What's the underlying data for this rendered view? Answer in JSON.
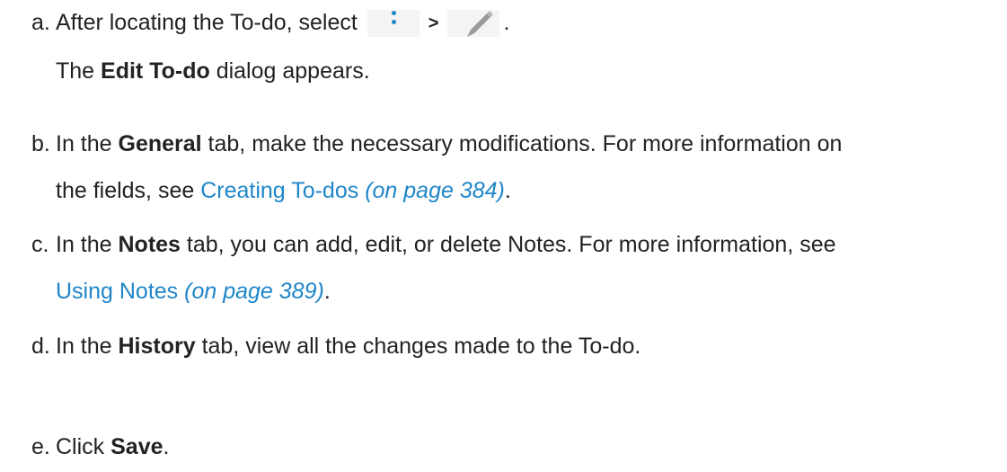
{
  "steps": [
    {
      "marker": "a.",
      "line1": {
        "prefix": "After locating the To-do, select",
        "separator": ">",
        "suffix": "."
      },
      "line2": {
        "pre": "The ",
        "bold": "Edit To-do",
        "post": " dialog appears."
      },
      "icons": [
        "kebab-menu-icon",
        "pencil-edit-icon"
      ]
    },
    {
      "marker": "b.",
      "line1": {
        "pre": "In the ",
        "bold": "General",
        "post": " tab, make the necessary modifications. For more information on"
      },
      "line2": {
        "pre": "the fields, see ",
        "link": "Creating To-dos",
        "page": "(on page 384)",
        "post": "."
      }
    },
    {
      "marker": "c.",
      "line1": {
        "pre": "In the ",
        "bold": "Notes",
        "post": " tab, you can add, edit, or delete Notes. For more information, see"
      },
      "line2": {
        "link": "Using Notes",
        "page": "(on page 389)",
        "post": "."
      }
    },
    {
      "marker": "d.",
      "line1": {
        "pre": "In the ",
        "bold": "History",
        "post": " tab, view all the changes made to the To-do."
      }
    },
    {
      "marker": "e.",
      "line1": {
        "pre": "Click ",
        "bold": "Save",
        "post": "."
      }
    }
  ],
  "colors": {
    "text": "#222222",
    "link": "#1f86c8",
    "icon_bg": "#f4f4f4",
    "pencil": "#9a9a9a"
  }
}
